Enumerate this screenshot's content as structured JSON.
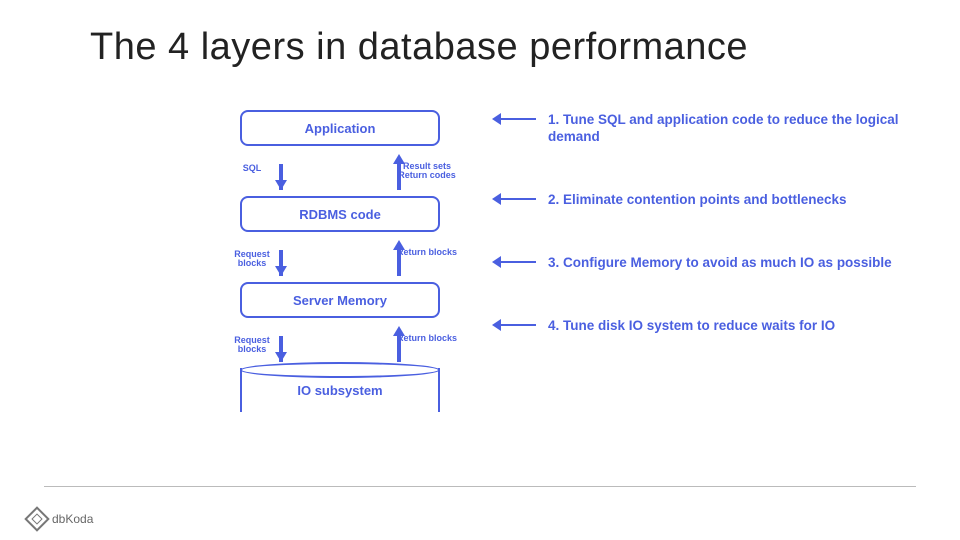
{
  "title": "The 4 layers in database performance",
  "layers": [
    {
      "name": "Application"
    },
    {
      "name": "RDBMS code"
    },
    {
      "name": "Server Memory"
    },
    {
      "name": "IO subsystem"
    }
  ],
  "flows": [
    {
      "down": "SQL",
      "up": "Result sets\nReturn codes"
    },
    {
      "down": "Request\nblocks",
      "up": "Return\nblocks"
    },
    {
      "down": "Request\nblocks",
      "up": "Return\nblocks"
    }
  ],
  "steps": [
    "1. Tune SQL and application code to reduce the logical demand",
    "2. Eliminate contention points and bottlenecks",
    "3. Configure Memory to avoid as much IO as possible",
    "4. Tune disk IO system to reduce waits for IO"
  ],
  "brand": "dbKoda"
}
